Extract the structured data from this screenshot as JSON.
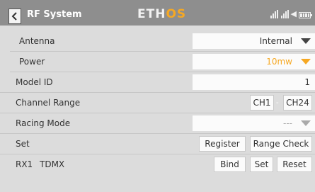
{
  "header": {
    "title": "RF System",
    "brand_main": "ETH",
    "brand_accent": "OS",
    "back_icon": "chevron-left-icon",
    "status_icons": [
      "signal-bars-icon",
      "signal-bars-icon",
      "speaker-icon",
      "battery-icon"
    ]
  },
  "rows": {
    "antenna": {
      "label": "Antenna",
      "value": "Internal"
    },
    "power": {
      "label": "Power",
      "value": "10mw"
    },
    "model_id": {
      "label": "Model ID",
      "value": "1"
    },
    "channel_range": {
      "label": "Channel Range",
      "from": "CH1",
      "separator": "-",
      "to": "CH24"
    },
    "racing_mode": {
      "label": "Racing Mode",
      "value": "---"
    },
    "set": {
      "label": "Set",
      "register": "Register",
      "range_check": "Range Check"
    },
    "rx1": {
      "label": "RX1",
      "mode": "TDMX",
      "bind": "Bind",
      "set": "Set",
      "reset": "Reset"
    }
  },
  "colors": {
    "accent": "#f6a823",
    "header": "#8e8e8e",
    "background": "#dcdcdc"
  }
}
